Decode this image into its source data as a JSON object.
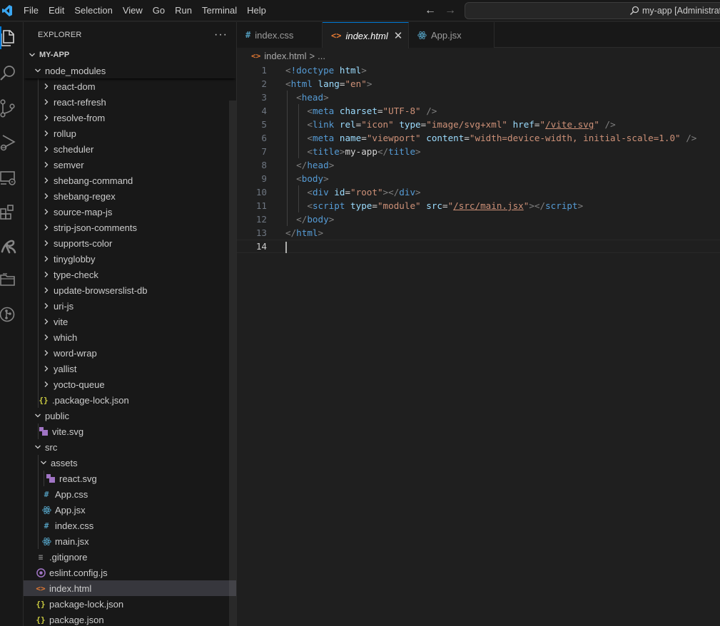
{
  "titlebar": {
    "menu": [
      "File",
      "Edit",
      "Selection",
      "View",
      "Go",
      "Run",
      "Terminal",
      "Help"
    ],
    "command_center": "my-app [Administrator]",
    "back_arrow": "←",
    "forward_arrow": "→"
  },
  "activity_bar": {
    "icons": [
      "explorer-icon",
      "search-icon",
      "source-control-icon",
      "run-debug-icon",
      "remote-explorer-icon",
      "extensions-icon",
      "prettier-icon",
      "project-manager-icon",
      "git-graph-icon"
    ]
  },
  "sidebar": {
    "title": "EXPLORER",
    "more": "···",
    "root_label": "MY-APP",
    "node_modules_label": "node_modules",
    "node_modules_children": [
      "react-dom",
      "react-refresh",
      "resolve-from",
      "rollup",
      "scheduler",
      "semver",
      "shebang-command",
      "shebang-regex",
      "source-map-js",
      "strip-json-comments",
      "supports-color",
      "tinyglobby",
      "type-check",
      "update-browserslist-db",
      "uri-js",
      "vite",
      "which",
      "word-wrap",
      "yallist",
      "yocto-queue"
    ],
    "package_lock_hidden": ".package-lock.json",
    "public_label": "public",
    "vite_svg": "vite.svg",
    "src_label": "src",
    "assets_label": "assets",
    "react_svg": "react.svg",
    "app_css": "App.css",
    "app_jsx": "App.jsx",
    "index_css": "index.css",
    "main_jsx": "main.jsx",
    "gitignore": ".gitignore",
    "eslint_config": "eslint.config.js",
    "index_html": "index.html",
    "package_lock": "package-lock.json",
    "package_json": "package.json"
  },
  "tabs": [
    {
      "label": "index.css",
      "icon": "#"
    },
    {
      "label": "index.html",
      "icon": "<>",
      "close": "✕"
    },
    {
      "label": "App.jsx",
      "icon": "⚛"
    }
  ],
  "breadcrumb": {
    "file": "index.html",
    "separator": ">",
    "ellipsis": "..."
  },
  "editor": {
    "line_numbers": [
      "1",
      "2",
      "3",
      "4",
      "5",
      "6",
      "7",
      "8",
      "9",
      "10",
      "11",
      "12",
      "13",
      "14"
    ],
    "code": {
      "l1_tag": "!doctype",
      "l1_attr": "html",
      "l2_tag": "html",
      "l2_attr": "lang",
      "l2_val": "\"en\"",
      "l3_tag": "head",
      "l4_tag": "meta",
      "l4_attr": "charset",
      "l4_val": "\"UTF-8\"",
      "l5_tag": "link",
      "l5_attr1": "rel",
      "l5_val1": "\"icon\"",
      "l5_attr2": "type",
      "l5_val2": "\"image/svg+xml\"",
      "l5_attr3": "href",
      "l5_val3_q": "\"",
      "l5_val3": "/vite.svg",
      "l5_val3_q2": "\"",
      "l6_tag": "meta",
      "l6_attr1": "name",
      "l6_val1": "\"viewport\"",
      "l6_attr2": "content",
      "l6_val2": "\"width=device-width, initial-scale=1.0\"",
      "l7_tag": "title",
      "l7_text": "my-app",
      "l7_close": "title",
      "l8_tag": "head",
      "l9_tag": "body",
      "l10_tag": "div",
      "l10_attr": "id",
      "l10_val": "\"root\"",
      "l10_close": "div",
      "l11_tag": "script",
      "l11_attr1": "type",
      "l11_val1": "\"module\"",
      "l11_attr2": "src",
      "l11_val2_q": "\"",
      "l11_val2": "/src/main.jsx",
      "l11_val2_q2": "\"",
      "l11_close": "script",
      "l12_tag": "body",
      "l13_tag": "html"
    }
  },
  "colors": {
    "accent": "#0078d4",
    "html_icon": "#e37933",
    "css_icon": "#519aba",
    "react_icon": "#519aba",
    "json_icon": "#cbcb41",
    "svg_icon": "#a074c4",
    "eslint_icon": "#a074c4"
  }
}
